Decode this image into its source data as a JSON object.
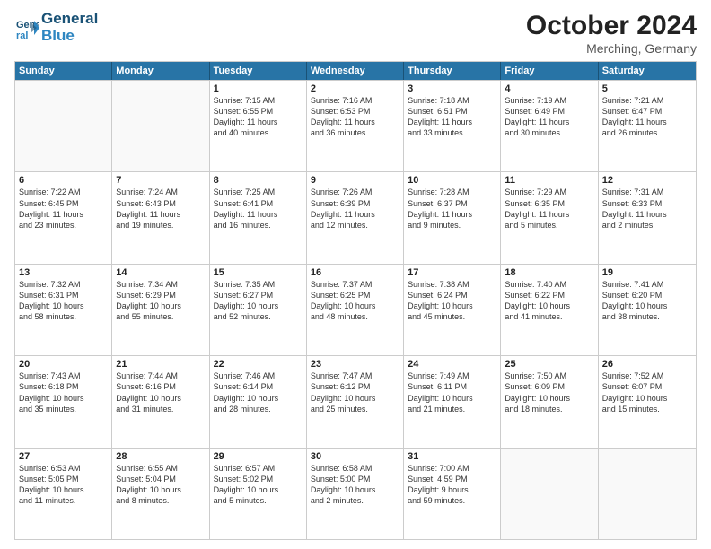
{
  "header": {
    "logo_line1": "General",
    "logo_line2": "Blue",
    "month": "October 2024",
    "location": "Merching, Germany"
  },
  "weekdays": [
    "Sunday",
    "Monday",
    "Tuesday",
    "Wednesday",
    "Thursday",
    "Friday",
    "Saturday"
  ],
  "rows": [
    [
      {
        "day": "",
        "info": "",
        "empty": true
      },
      {
        "day": "",
        "info": "",
        "empty": true
      },
      {
        "day": "1",
        "info": "Sunrise: 7:15 AM\nSunset: 6:55 PM\nDaylight: 11 hours\nand 40 minutes."
      },
      {
        "day": "2",
        "info": "Sunrise: 7:16 AM\nSunset: 6:53 PM\nDaylight: 11 hours\nand 36 minutes."
      },
      {
        "day": "3",
        "info": "Sunrise: 7:18 AM\nSunset: 6:51 PM\nDaylight: 11 hours\nand 33 minutes."
      },
      {
        "day": "4",
        "info": "Sunrise: 7:19 AM\nSunset: 6:49 PM\nDaylight: 11 hours\nand 30 minutes."
      },
      {
        "day": "5",
        "info": "Sunrise: 7:21 AM\nSunset: 6:47 PM\nDaylight: 11 hours\nand 26 minutes."
      }
    ],
    [
      {
        "day": "6",
        "info": "Sunrise: 7:22 AM\nSunset: 6:45 PM\nDaylight: 11 hours\nand 23 minutes."
      },
      {
        "day": "7",
        "info": "Sunrise: 7:24 AM\nSunset: 6:43 PM\nDaylight: 11 hours\nand 19 minutes."
      },
      {
        "day": "8",
        "info": "Sunrise: 7:25 AM\nSunset: 6:41 PM\nDaylight: 11 hours\nand 16 minutes."
      },
      {
        "day": "9",
        "info": "Sunrise: 7:26 AM\nSunset: 6:39 PM\nDaylight: 11 hours\nand 12 minutes."
      },
      {
        "day": "10",
        "info": "Sunrise: 7:28 AM\nSunset: 6:37 PM\nDaylight: 11 hours\nand 9 minutes."
      },
      {
        "day": "11",
        "info": "Sunrise: 7:29 AM\nSunset: 6:35 PM\nDaylight: 11 hours\nand 5 minutes."
      },
      {
        "day": "12",
        "info": "Sunrise: 7:31 AM\nSunset: 6:33 PM\nDaylight: 11 hours\nand 2 minutes."
      }
    ],
    [
      {
        "day": "13",
        "info": "Sunrise: 7:32 AM\nSunset: 6:31 PM\nDaylight: 10 hours\nand 58 minutes."
      },
      {
        "day": "14",
        "info": "Sunrise: 7:34 AM\nSunset: 6:29 PM\nDaylight: 10 hours\nand 55 minutes."
      },
      {
        "day": "15",
        "info": "Sunrise: 7:35 AM\nSunset: 6:27 PM\nDaylight: 10 hours\nand 52 minutes."
      },
      {
        "day": "16",
        "info": "Sunrise: 7:37 AM\nSunset: 6:25 PM\nDaylight: 10 hours\nand 48 minutes."
      },
      {
        "day": "17",
        "info": "Sunrise: 7:38 AM\nSunset: 6:24 PM\nDaylight: 10 hours\nand 45 minutes."
      },
      {
        "day": "18",
        "info": "Sunrise: 7:40 AM\nSunset: 6:22 PM\nDaylight: 10 hours\nand 41 minutes."
      },
      {
        "day": "19",
        "info": "Sunrise: 7:41 AM\nSunset: 6:20 PM\nDaylight: 10 hours\nand 38 minutes."
      }
    ],
    [
      {
        "day": "20",
        "info": "Sunrise: 7:43 AM\nSunset: 6:18 PM\nDaylight: 10 hours\nand 35 minutes."
      },
      {
        "day": "21",
        "info": "Sunrise: 7:44 AM\nSunset: 6:16 PM\nDaylight: 10 hours\nand 31 minutes."
      },
      {
        "day": "22",
        "info": "Sunrise: 7:46 AM\nSunset: 6:14 PM\nDaylight: 10 hours\nand 28 minutes."
      },
      {
        "day": "23",
        "info": "Sunrise: 7:47 AM\nSunset: 6:12 PM\nDaylight: 10 hours\nand 25 minutes."
      },
      {
        "day": "24",
        "info": "Sunrise: 7:49 AM\nSunset: 6:11 PM\nDaylight: 10 hours\nand 21 minutes."
      },
      {
        "day": "25",
        "info": "Sunrise: 7:50 AM\nSunset: 6:09 PM\nDaylight: 10 hours\nand 18 minutes."
      },
      {
        "day": "26",
        "info": "Sunrise: 7:52 AM\nSunset: 6:07 PM\nDaylight: 10 hours\nand 15 minutes."
      }
    ],
    [
      {
        "day": "27",
        "info": "Sunrise: 6:53 AM\nSunset: 5:05 PM\nDaylight: 10 hours\nand 11 minutes."
      },
      {
        "day": "28",
        "info": "Sunrise: 6:55 AM\nSunset: 5:04 PM\nDaylight: 10 hours\nand 8 minutes."
      },
      {
        "day": "29",
        "info": "Sunrise: 6:57 AM\nSunset: 5:02 PM\nDaylight: 10 hours\nand 5 minutes."
      },
      {
        "day": "30",
        "info": "Sunrise: 6:58 AM\nSunset: 5:00 PM\nDaylight: 10 hours\nand 2 minutes."
      },
      {
        "day": "31",
        "info": "Sunrise: 7:00 AM\nSunset: 4:59 PM\nDaylight: 9 hours\nand 59 minutes."
      },
      {
        "day": "",
        "info": "",
        "empty": true
      },
      {
        "day": "",
        "info": "",
        "empty": true
      }
    ]
  ]
}
